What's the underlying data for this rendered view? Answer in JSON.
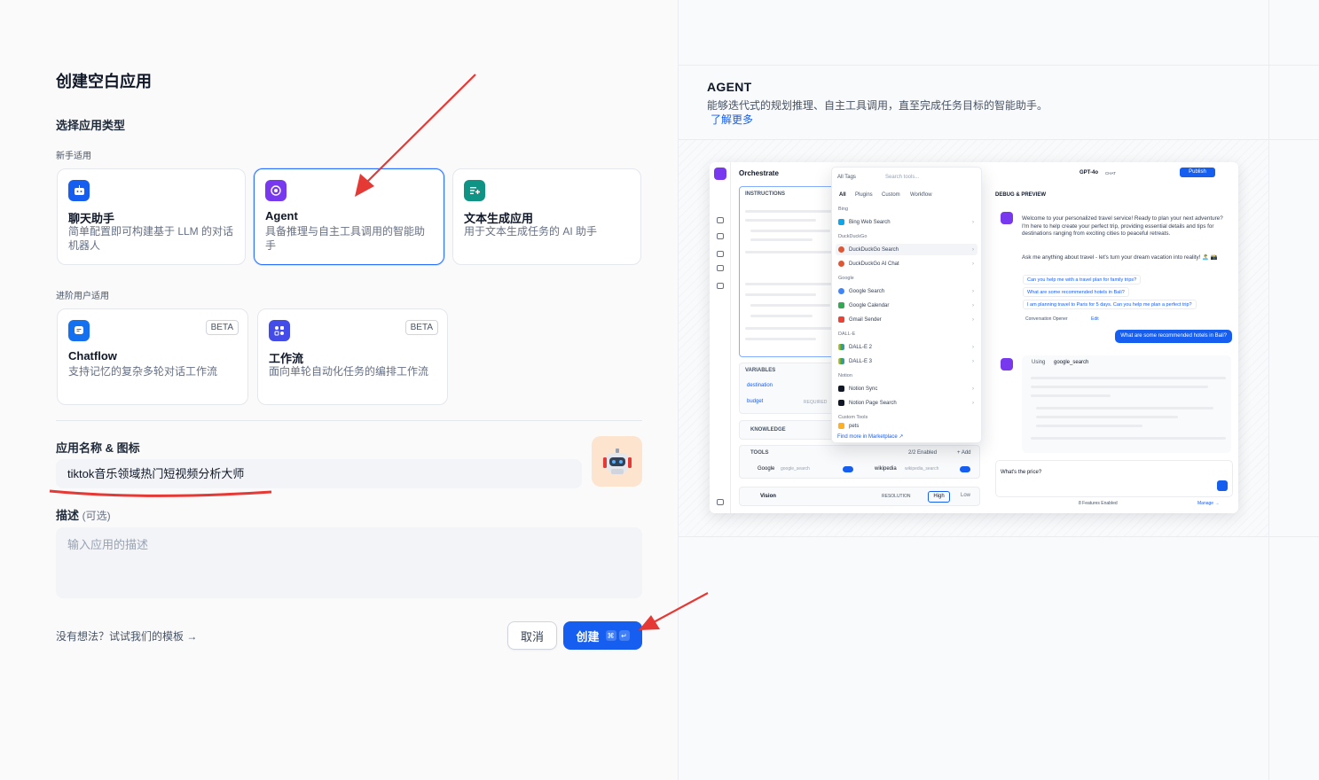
{
  "form": {
    "page_title": "创建空白应用",
    "section_title": "选择应用类型",
    "group_beginner": "新手适用",
    "group_advanced": "进阶用户适用",
    "cards": [
      {
        "title": "聊天助手",
        "desc": "简单配置即可构建基于 LLM 的对话机器人",
        "icon": "chat-bot-icon",
        "color": "#155eef"
      },
      {
        "title": "Agent",
        "desc": "具备推理与自主工具调用的智能助手",
        "icon": "agent-icon",
        "color": "#7839ee"
      },
      {
        "title": "文本生成应用",
        "desc": "用于文本生成任务的 AI 助手",
        "icon": "text-gen-icon",
        "color": "#0e9384"
      },
      {
        "title": "Chatflow",
        "desc": "支持记忆的复杂多轮对话工作流",
        "badge": "BETA",
        "icon": "chatflow-icon",
        "color": "#1570ef"
      },
      {
        "title": "工作流",
        "desc": "面向单轮自动化任务的编排工作流",
        "badge": "BETA",
        "icon": "workflow-icon",
        "color": "#444ce7"
      }
    ],
    "name_label": "应用名称 & 图标",
    "name_value": "tiktok音乐领域热门短视频分析大师",
    "desc_label": "描述",
    "desc_optional": "(可选)",
    "desc_placeholder": "输入应用的描述",
    "template_link": "没有想法？试试我们的模板",
    "cancel_label": "取消",
    "create_label": "创建",
    "create_kbd": [
      "⌘",
      "↵"
    ]
  },
  "preview": {
    "title": "AGENT",
    "desc": "能够迭代式的规划推理、自主工具调用，直至完成任务目标的智能助手。",
    "learn_more": "了解更多",
    "screenshot": {
      "orchestrate": "Orchestrate",
      "instructions": "INSTRUCTIONS",
      "variables": "VARIABLES",
      "var1": "destination",
      "var2": "budget",
      "required": "REQUIRED",
      "knowledge": "KNOWLEDGE",
      "tools": "TOOLS",
      "tools_enabled": "2/2 Enabled",
      "add": "+ Add",
      "tool1": "Google",
      "tool1_id": "google_search",
      "tool2": "wikipedia",
      "tool2_id": "wikipedia_search",
      "vision": "Vision",
      "resolution": "RESOLUTION",
      "high": "High",
      "low": "Low",
      "model": "GPT-4o",
      "chat": "CHAT",
      "publish": "Publish",
      "debug": "DEBUG & PREVIEW",
      "tags": "All Tags",
      "search": "Search tools...",
      "tabs": [
        "All",
        "Plugins",
        "Custom",
        "Workflow"
      ],
      "groups": [
        {
          "name": "Bing",
          "items": [
            "Bing Web Search"
          ]
        },
        {
          "name": "DuckDuckGo",
          "items": [
            "DuckDuckGo Search",
            "DuckDuckGo AI Chat"
          ]
        },
        {
          "name": "Google",
          "items": [
            "Google Search",
            "Google Calendar",
            "Gmail Sender"
          ]
        },
        {
          "name": "DALL-E",
          "items": [
            "DALL-E 2",
            "DALL-E 3"
          ]
        },
        {
          "name": "Notion",
          "items": [
            "Notion Sync",
            "Notion Page Search"
          ]
        },
        {
          "name": "Custom Tools",
          "items": [
            "pets"
          ]
        }
      ],
      "find_more": "Find more in Marketplace ↗",
      "welcome": "Welcome to your personalized travel service! Ready to plan your next adventure? I'm here to help create your perfect trip, providing essential details and tips for destinations ranging from exciting cities to peaceful retreats.",
      "ask": "Ask me anything about travel - let's turn your dream vacation into reality! 🏝️ 📸",
      "suggestions": [
        "Can you help me with a travel plan for family trips?",
        "What are some recommended hotels in Bali?",
        "I am planning travel to Paris for 5 days. Can you help me plan a perfect trip?"
      ],
      "opener": "Conversation Opener",
      "edit": "Edit",
      "user_msg": "What are some recommended hotels in Bali?",
      "using": "Using",
      "using_tool": "google_search",
      "input": "What's the price?",
      "features": "8 Features Enabled",
      "manage": "Manage →"
    }
  },
  "colors": {
    "primary": "#155eef",
    "annotation_arrow": "#e53935"
  }
}
